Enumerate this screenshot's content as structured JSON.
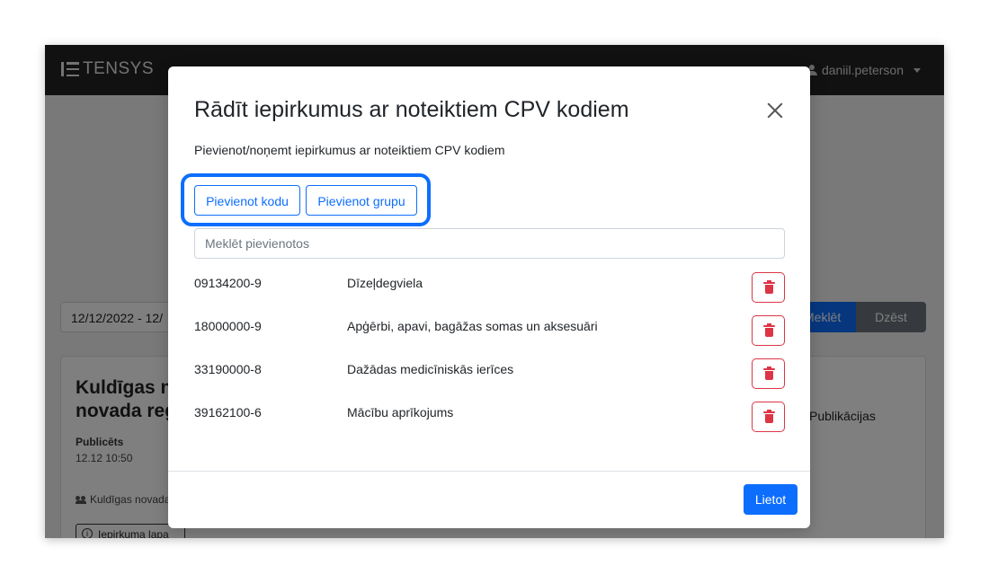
{
  "app": {
    "brand": "TENSYS",
    "user_name": "daniil.peterson"
  },
  "background": {
    "date_range": "12/12/2022 - 12/",
    "search_button": "Meklēt",
    "clear_button": "Dzēst",
    "card": {
      "title_line1": "Kuldīgas no",
      "title_line2": "novada reģ",
      "published_label": "Publicēts",
      "published_date": "12.12 10:50",
      "organization": "Kuldīgas novada",
      "procurement_link": "Iepirkuma lapa",
      "publications_label": "Publikācijas"
    }
  },
  "modal": {
    "title": "Rādīt iepirkumus ar noteiktiem CPV kodiem",
    "description": "Pievienot/noņemt iepirkumus ar noteiktiem CPV kodiem",
    "add_code_button": "Pievienot kodu",
    "add_group_button": "Pievienot grupu",
    "search_placeholder": "Meklēt pievienotos",
    "items": [
      {
        "code": "09134200-9",
        "name": "Dīzeļdegviela"
      },
      {
        "code": "18000000-9",
        "name": "Apģērbi, apavi, bagāžas somas un aksesuāri"
      },
      {
        "code": "33190000-8",
        "name": "Dažādas medicīniskās ierīces"
      },
      {
        "code": "39162100-6",
        "name": "Mācību aprīkojums"
      }
    ],
    "apply_button": "Lietot"
  },
  "colors": {
    "primary": "#0d6efd",
    "danger": "#dc3545",
    "navbar": "#222222"
  }
}
